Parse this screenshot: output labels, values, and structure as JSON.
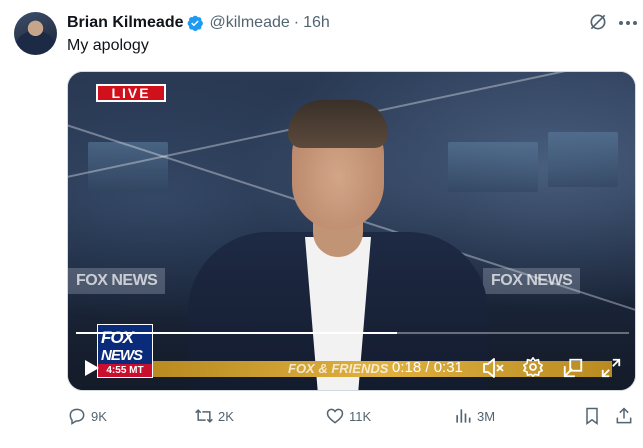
{
  "tweet": {
    "author_name": "Brian Kilmeade",
    "handle": "@kilmeade",
    "separator": "·",
    "time": "16h",
    "text": "My apology"
  },
  "video": {
    "live_badge": "LIVE",
    "bg_logo_left": "FOX NEWS",
    "bg_logo_right": "FOX NEWS",
    "chyron_text": "FOX & FRIENDS",
    "fox_logo_top": "FOX",
    "fox_logo_bottom": "NEWS",
    "fox_clock": "4:55 MT",
    "time_display": "0:18 / 0:31",
    "progress_fraction": 0.58
  },
  "actions": {
    "reply_count": "9K",
    "retweet_count": "2K",
    "like_count": "11K",
    "views_count": "3M"
  },
  "colors": {
    "verified": "#1d9bf0",
    "secondary_text": "#536471",
    "live_red": "#d0101b"
  },
  "icons": [
    "verified-badge-icon",
    "grok-icon",
    "more-icon",
    "play-icon",
    "volume-muted-icon",
    "settings-icon",
    "dock-icon",
    "fullscreen-icon",
    "reply-icon",
    "retweet-icon",
    "like-icon",
    "views-icon",
    "bookmark-icon",
    "share-icon"
  ]
}
